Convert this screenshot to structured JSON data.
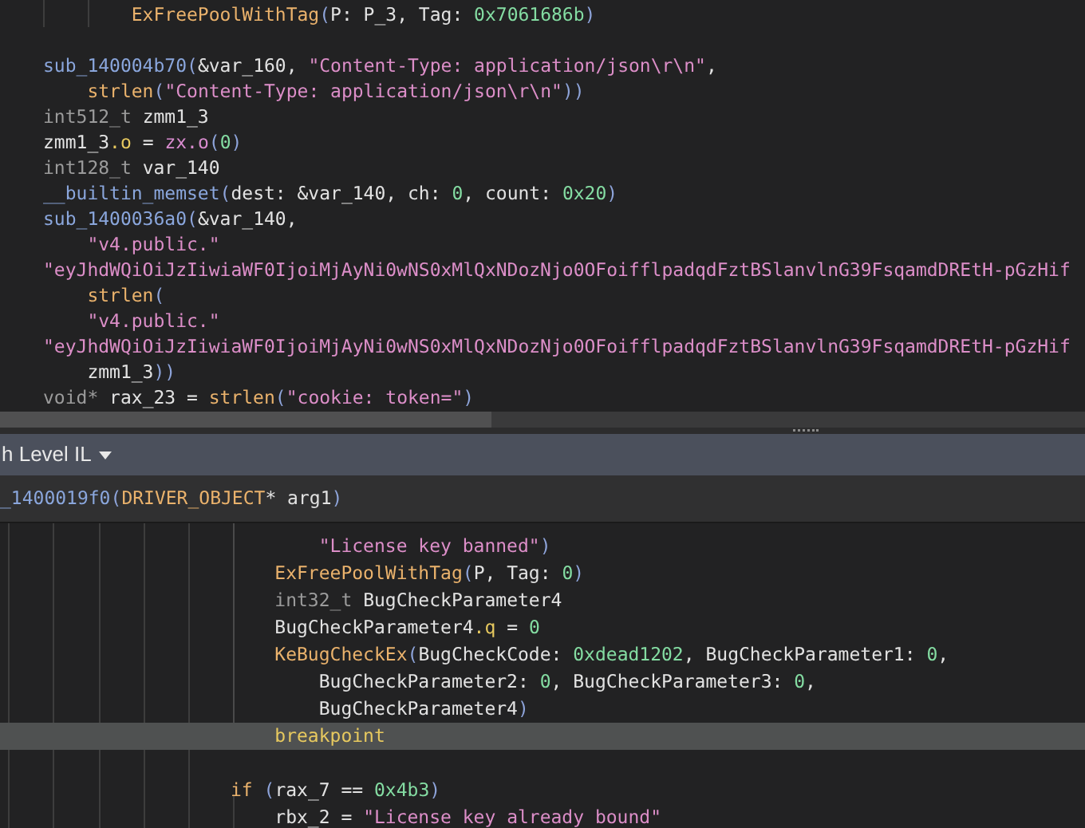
{
  "top_pane": {
    "lines": [
      {
        "kind": "code",
        "tokens": [
          {
            "kind": "call",
            "text": "        ExFreePoolWithTag"
          },
          {
            "kind": "punct",
            "text": "("
          },
          {
            "kind": "plain",
            "text": "P: P_3, Tag: "
          },
          {
            "kind": "num",
            "text": "0x7061686b"
          },
          {
            "kind": "punct",
            "text": ")"
          }
        ]
      },
      {
        "kind": "blank"
      },
      {
        "kind": "code",
        "tokens": [
          {
            "kind": "sub",
            "text": "sub_140004b70"
          },
          {
            "kind": "punct",
            "text": "("
          },
          {
            "kind": "plain",
            "text": "&var_160, "
          },
          {
            "kind": "str",
            "text": "\"Content-Type: application/json\\r\\n\""
          },
          {
            "kind": "plain",
            "text": ","
          }
        ]
      },
      {
        "kind": "code",
        "tokens": [
          {
            "kind": "call",
            "text": "    strlen"
          },
          {
            "kind": "punct",
            "text": "("
          },
          {
            "kind": "str",
            "text": "\"Content-Type: application/json\\r\\n\""
          },
          {
            "kind": "punct",
            "text": "))"
          }
        ]
      },
      {
        "kind": "code",
        "tokens": [
          {
            "kind": "type",
            "text": "int512_t "
          },
          {
            "kind": "plain",
            "text": "zmm1_3"
          }
        ]
      },
      {
        "kind": "code",
        "tokens": [
          {
            "kind": "plain",
            "text": "zmm1_3"
          },
          {
            "kind": "field",
            "text": ".o"
          },
          {
            "kind": "plain",
            "text": " = "
          },
          {
            "kind": "magenta",
            "text": "zx.o"
          },
          {
            "kind": "punct",
            "text": "("
          },
          {
            "kind": "num",
            "text": "0"
          },
          {
            "kind": "punct",
            "text": ")"
          }
        ]
      },
      {
        "kind": "code",
        "tokens": [
          {
            "kind": "type",
            "text": "int128_t "
          },
          {
            "kind": "plain",
            "text": "var_140"
          }
        ]
      },
      {
        "kind": "code",
        "tokens": [
          {
            "kind": "sub",
            "text": "__builtin_memset"
          },
          {
            "kind": "punct",
            "text": "("
          },
          {
            "kind": "plain",
            "text": "dest: &var_140, ch: "
          },
          {
            "kind": "num",
            "text": "0"
          },
          {
            "kind": "plain",
            "text": ", count: "
          },
          {
            "kind": "num",
            "text": "0x20"
          },
          {
            "kind": "punct",
            "text": ")"
          }
        ]
      },
      {
        "kind": "code",
        "tokens": [
          {
            "kind": "sub",
            "text": "sub_1400036a0"
          },
          {
            "kind": "punct",
            "text": "("
          },
          {
            "kind": "plain",
            "text": "&var_140,"
          }
        ]
      },
      {
        "kind": "code",
        "tokens": [
          {
            "kind": "str",
            "text": "    \"v4.public.\""
          }
        ]
      },
      {
        "kind": "code",
        "tokens": [
          {
            "kind": "str",
            "text": "\"eyJhdWQiOiJzIiwiaWF0IjoiMjAyNi0wNS0xMlQxNDozNjo0OFoifflpadqdFztBSlanvlnG39FsqamdDREtH-pGzHif"
          }
        ]
      },
      {
        "kind": "code",
        "tokens": [
          {
            "kind": "call",
            "text": "    strlen"
          },
          {
            "kind": "punct",
            "text": "("
          }
        ]
      },
      {
        "kind": "code",
        "tokens": [
          {
            "kind": "str",
            "text": "    \"v4.public.\""
          }
        ]
      },
      {
        "kind": "code",
        "tokens": [
          {
            "kind": "str",
            "text": "\"eyJhdWQiOiJzIiwiaWF0IjoiMjAyNi0wNS0xMlQxNDozNjo0OFoifflpadqdFztBSlanvlnG39FsqamdDREtH-pGzHif"
          }
        ]
      },
      {
        "kind": "code",
        "tokens": [
          {
            "kind": "plain",
            "text": "    zmm1_3"
          },
          {
            "kind": "punct",
            "text": "))"
          }
        ]
      },
      {
        "kind": "code",
        "tokens": [
          {
            "kind": "type",
            "text": "void* "
          },
          {
            "kind": "plain",
            "text": "rax_23 = "
          },
          {
            "kind": "call",
            "text": "strlen"
          },
          {
            "kind": "punct",
            "text": "("
          },
          {
            "kind": "str",
            "text": "\"cookie: token=\""
          },
          {
            "kind": "punct",
            "text": ")"
          }
        ]
      }
    ]
  },
  "il_selector": {
    "label": "h Level IL"
  },
  "signature": [
    {
      "kind": "sub",
      "text": "_1400019f0"
    },
    {
      "kind": "punct",
      "text": "("
    },
    {
      "kind": "call",
      "text": "DRIVER_OBJECT"
    },
    {
      "kind": "plain",
      "text": "* arg1"
    },
    {
      "kind": "punct",
      "text": ")"
    }
  ],
  "bottom_pane": {
    "lines": [
      {
        "kind": "code",
        "selected": false,
        "tokens": [
          {
            "kind": "str",
            "text": "                            \"License key banned\""
          },
          {
            "kind": "punct",
            "text": ")"
          }
        ]
      },
      {
        "kind": "code",
        "selected": false,
        "tokens": [
          {
            "kind": "call",
            "text": "                        ExFreePoolWithTag"
          },
          {
            "kind": "punct",
            "text": "("
          },
          {
            "kind": "plain",
            "text": "P, Tag: "
          },
          {
            "kind": "num",
            "text": "0"
          },
          {
            "kind": "punct",
            "text": ")"
          }
        ]
      },
      {
        "kind": "code",
        "selected": false,
        "tokens": [
          {
            "kind": "type",
            "text": "                        int32_t "
          },
          {
            "kind": "plain",
            "text": "BugCheckParameter4"
          }
        ]
      },
      {
        "kind": "code",
        "selected": false,
        "tokens": [
          {
            "kind": "plain",
            "text": "                        BugCheckParameter4"
          },
          {
            "kind": "field",
            "text": ".q"
          },
          {
            "kind": "plain",
            "text": " = "
          },
          {
            "kind": "num",
            "text": "0"
          }
        ]
      },
      {
        "kind": "code",
        "selected": false,
        "tokens": [
          {
            "kind": "call",
            "text": "                        KeBugCheckEx"
          },
          {
            "kind": "punct",
            "text": "("
          },
          {
            "kind": "plain",
            "text": "BugCheckCode: "
          },
          {
            "kind": "num",
            "text": "0xdead1202"
          },
          {
            "kind": "plain",
            "text": ", BugCheckParameter1: "
          },
          {
            "kind": "num",
            "text": "0"
          },
          {
            "kind": "plain",
            "text": ","
          }
        ]
      },
      {
        "kind": "code",
        "selected": false,
        "tokens": [
          {
            "kind": "plain",
            "text": "                            BugCheckParameter2: "
          },
          {
            "kind": "num",
            "text": "0"
          },
          {
            "kind": "plain",
            "text": ", BugCheckParameter3: "
          },
          {
            "kind": "num",
            "text": "0"
          },
          {
            "kind": "plain",
            "text": ","
          }
        ]
      },
      {
        "kind": "code",
        "selected": false,
        "tokens": [
          {
            "kind": "plain",
            "text": "                            BugCheckParameter4"
          },
          {
            "kind": "punct",
            "text": ")"
          }
        ]
      },
      {
        "kind": "code",
        "selected": true,
        "tokens": [
          {
            "kind": "field",
            "text": "                        breakpoint"
          }
        ]
      },
      {
        "kind": "blank"
      },
      {
        "kind": "code",
        "selected": false,
        "tokens": [
          {
            "kind": "keyword",
            "text": "                    if "
          },
          {
            "kind": "punct",
            "text": "("
          },
          {
            "kind": "plain",
            "text": "rax_7 == "
          },
          {
            "kind": "num",
            "text": "0x4b3"
          },
          {
            "kind": "punct",
            "text": ")"
          }
        ]
      },
      {
        "kind": "code",
        "selected": false,
        "tokens": [
          {
            "kind": "plain",
            "text": "                        rbx_2 = "
          },
          {
            "kind": "str",
            "text": "\"License key already bound\""
          }
        ]
      }
    ]
  }
}
